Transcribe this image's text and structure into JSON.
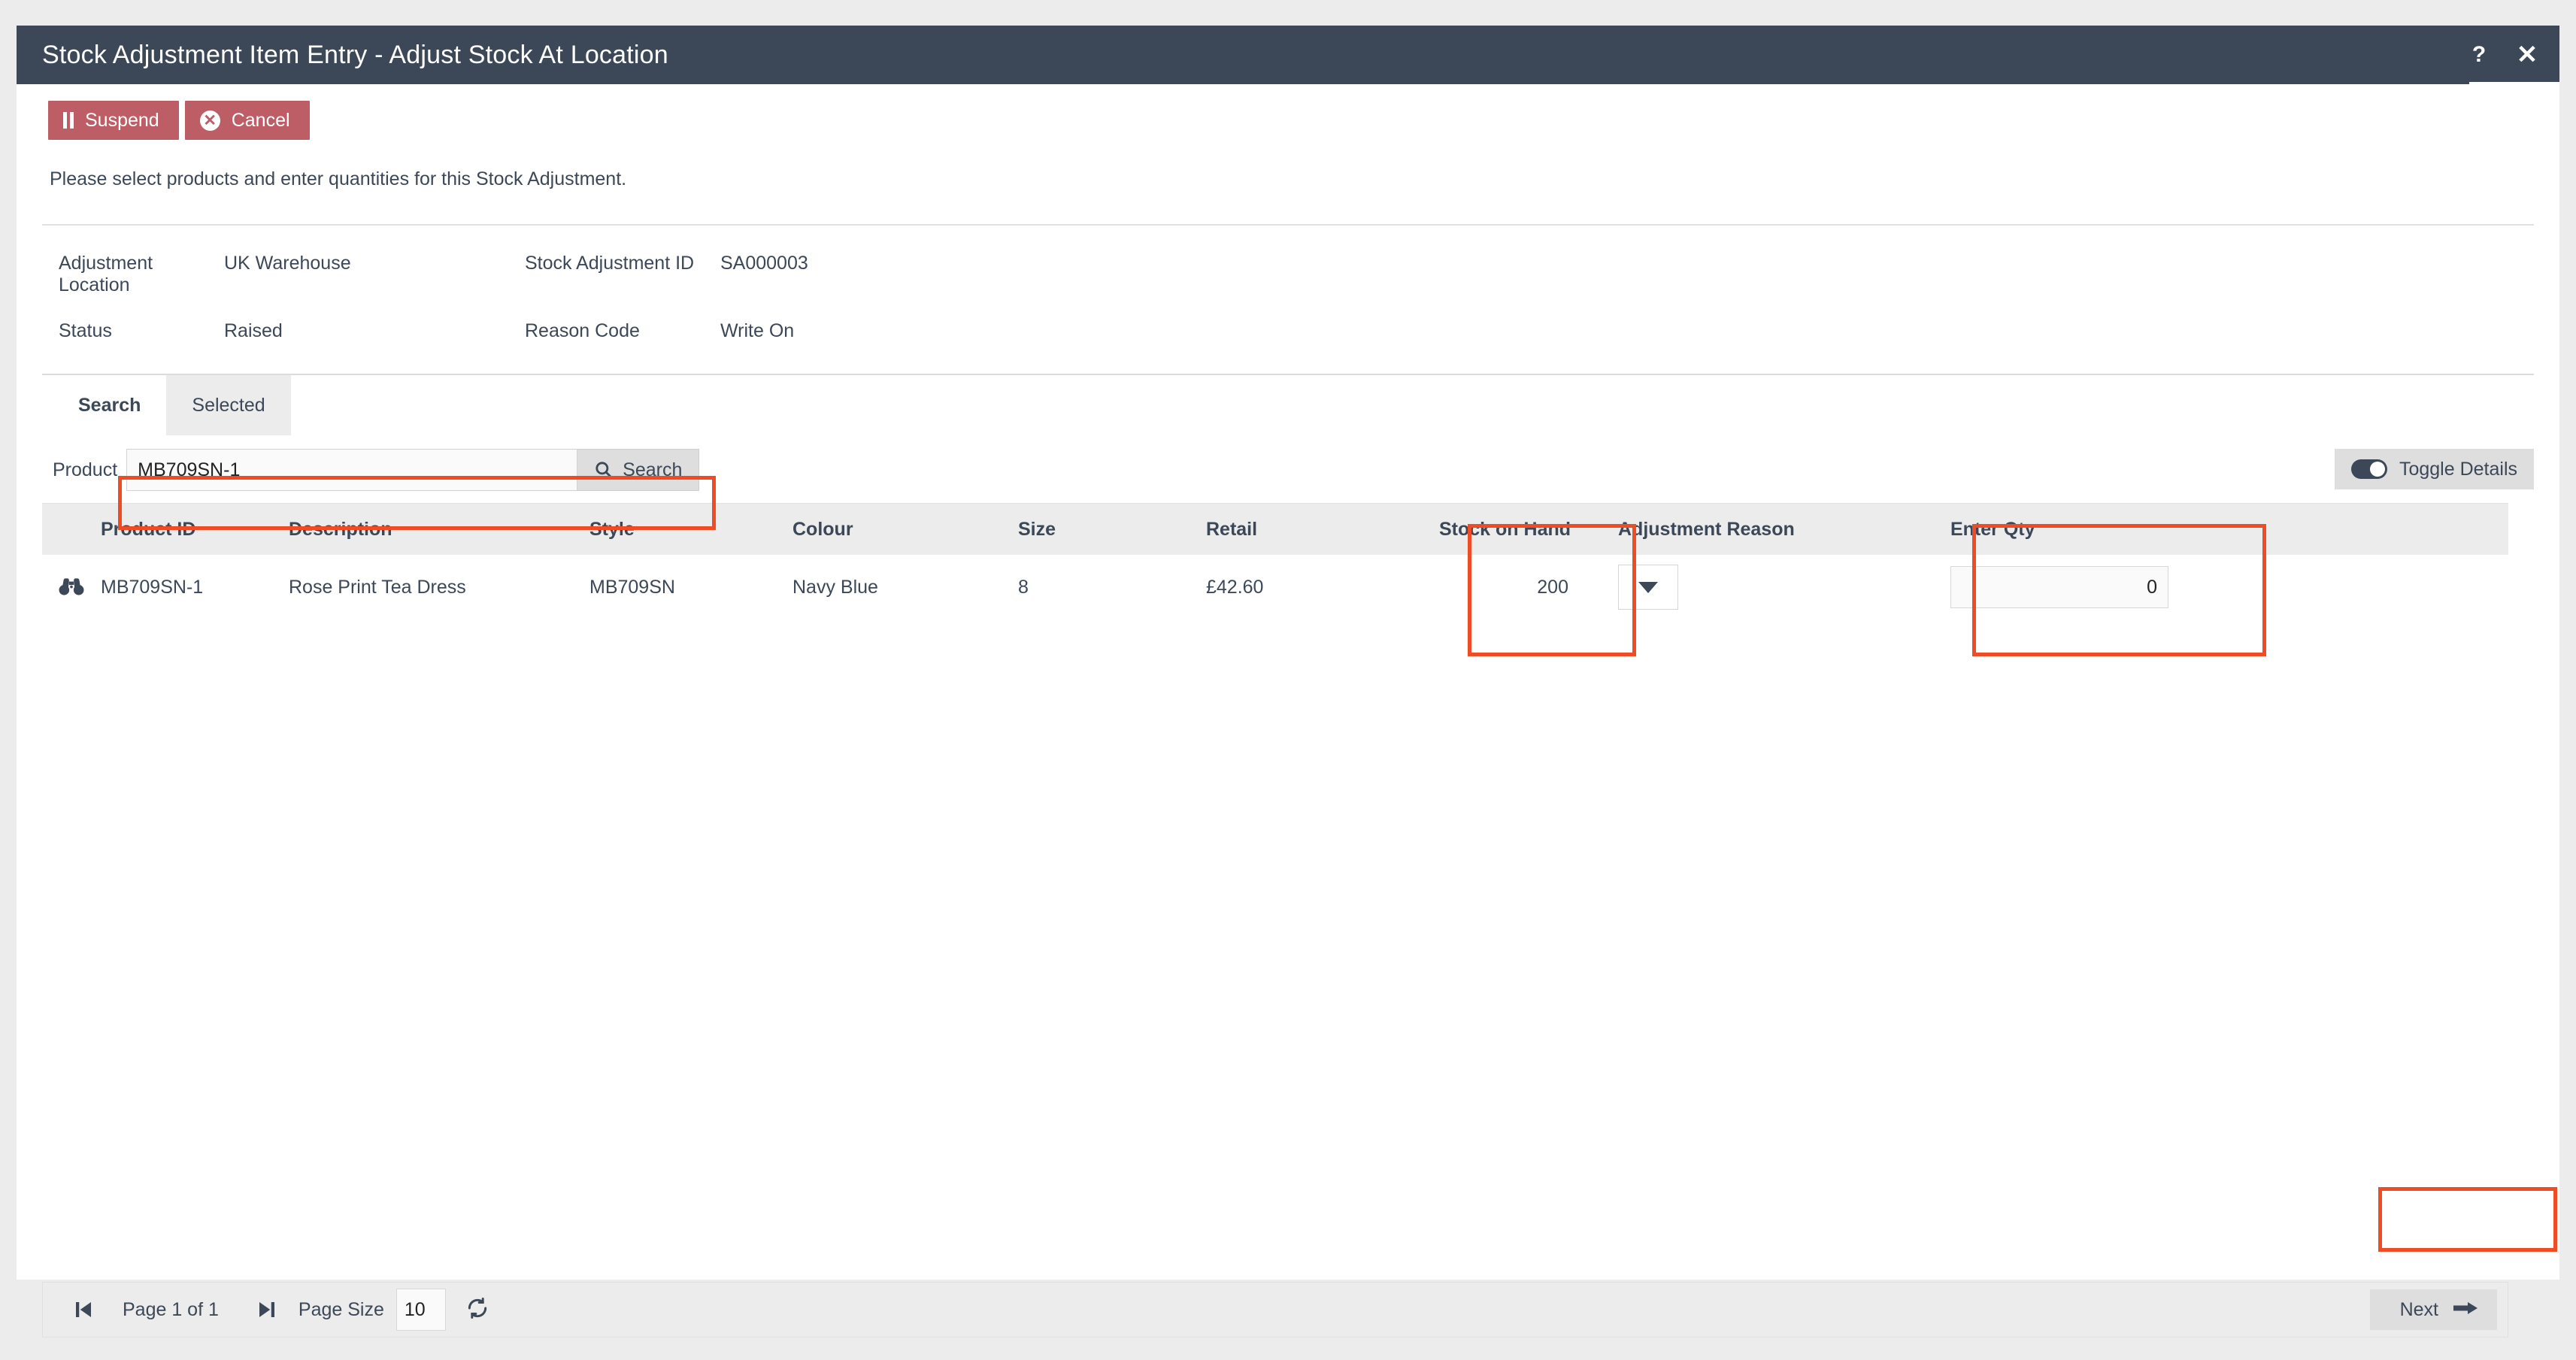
{
  "window": {
    "title": "Stock Adjustment Item Entry - Adjust Stock At Location",
    "help_icon": "question-mark-icon",
    "close_icon": "close-icon"
  },
  "toolbar": {
    "suspend_label": "Suspend",
    "cancel_label": "Cancel",
    "button_color": "#bd5d66"
  },
  "instruction": "Please select products and enter quantities for this Stock Adjustment.",
  "details": {
    "adjustment_location_label": "Adjustment Location",
    "adjustment_location_value": "UK Warehouse",
    "stock_adjustment_id_label": "Stock Adjustment ID",
    "stock_adjustment_id_value": "SA000003",
    "status_label": "Status",
    "status_value": "Raised",
    "reason_code_label": "Reason Code",
    "reason_code_value": "Write On"
  },
  "tabs": [
    {
      "label": "Search",
      "active": true
    },
    {
      "label": "Selected",
      "active": false
    }
  ],
  "search": {
    "label": "Product",
    "value": "MB709SN-1",
    "placeholder": "",
    "button_label": "Search",
    "button_icon": "search-icon"
  },
  "toggle_details": {
    "label": "Toggle Details",
    "state": "on"
  },
  "grid": {
    "columns": [
      "Product ID",
      "Description",
      "Style",
      "Colour",
      "Size",
      "Retail",
      "Stock on Hand",
      "Adjustment Reason",
      "Enter Qty"
    ],
    "rows": [
      {
        "view_icon": "binoculars-icon",
        "product_id": "MB709SN-1",
        "description": "Rose Print Tea Dress",
        "style": "MB709SN",
        "colour": "Navy Blue",
        "size": "8",
        "retail": "£42.60",
        "stock_on_hand": "200",
        "adjustment_reason": "",
        "enter_qty": "0"
      }
    ]
  },
  "pagination": {
    "first_icon": "first-page-icon",
    "page_text": "Page 1 of 1",
    "last_icon": "last-page-icon",
    "page_size_label": "Page Size",
    "page_size_value": "10",
    "refresh_icon": "refresh-icon"
  },
  "next_button": {
    "label": "Next",
    "icon": "arrow-right-icon"
  },
  "annotations": {
    "color": "#ef4b24",
    "boxes": [
      "search-field-highlight",
      "stock-on-hand-highlight",
      "enter-qty-highlight",
      "next-button-highlight"
    ]
  }
}
